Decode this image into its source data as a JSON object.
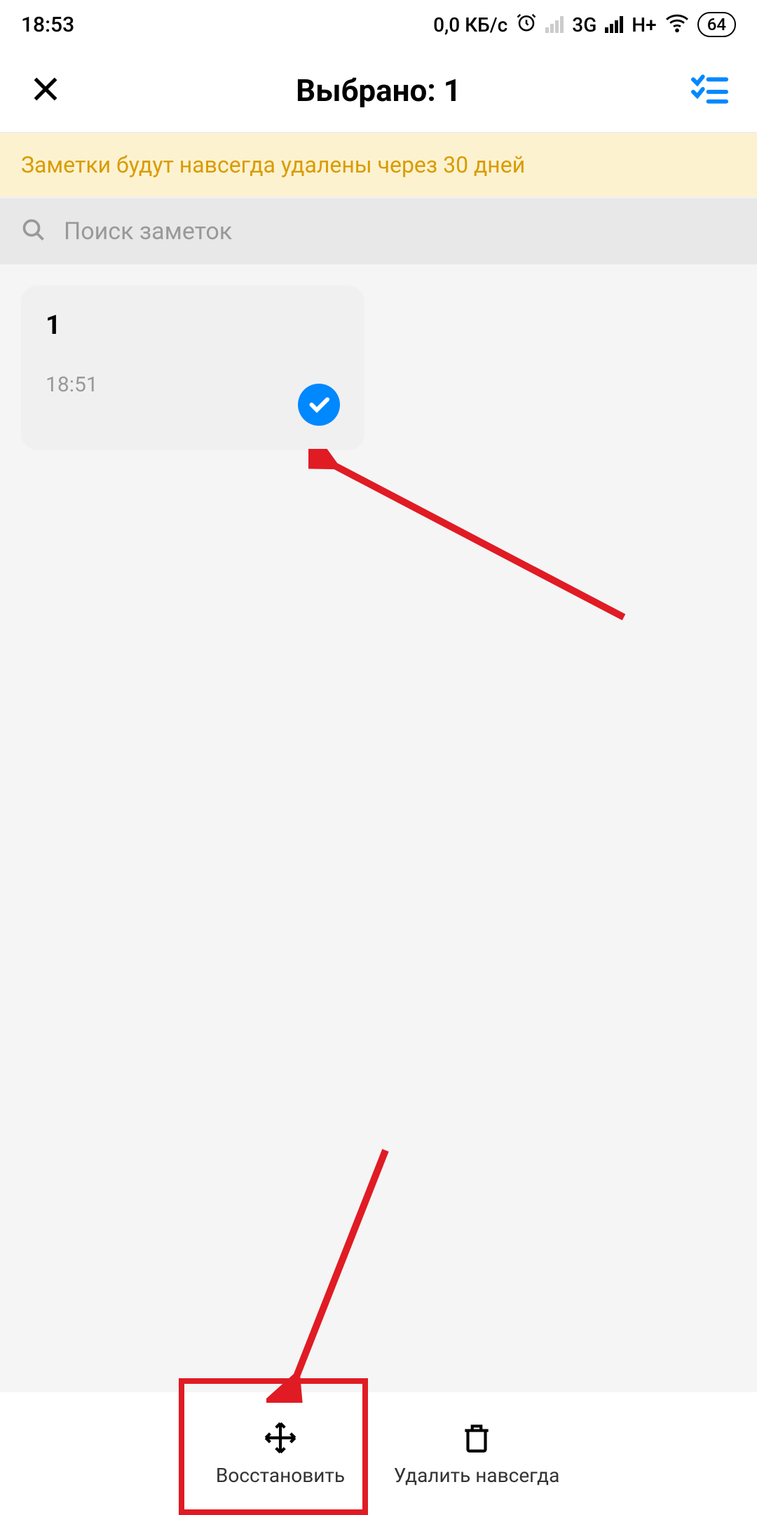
{
  "status_bar": {
    "time": "18:53",
    "data_speed": "0,0 КБ/с",
    "network1": "3G",
    "network2": "H+",
    "battery": "64"
  },
  "header": {
    "title": "Выбрано: 1"
  },
  "banner": {
    "text": "Заметки будут навсегда удалены через 30 дней"
  },
  "search": {
    "placeholder": "Поиск заметок"
  },
  "notes": [
    {
      "title": "1",
      "time": "18:51",
      "selected": true
    }
  ],
  "bottom_actions": {
    "restore": "Восстановить",
    "delete": "Удалить навсегда"
  }
}
